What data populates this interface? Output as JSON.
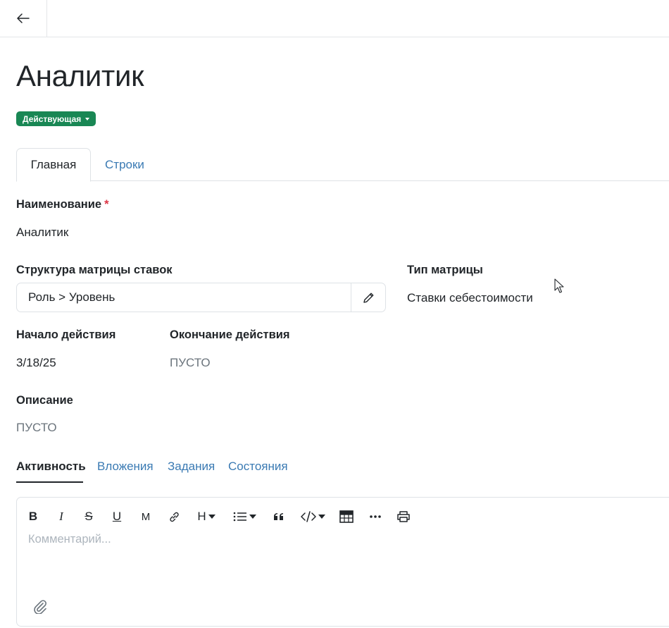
{
  "header": {
    "title": "Аналитик",
    "status": "Действующая"
  },
  "tabs": [
    {
      "label": "Главная",
      "active": true
    },
    {
      "label": "Строки",
      "active": false
    }
  ],
  "fields": {
    "name": {
      "label": "Наименование",
      "required_mark": "*",
      "value": "Аналитик"
    },
    "matrix_structure": {
      "label": "Структура матрицы ставок",
      "value": "Роль > Уровень"
    },
    "matrix_type": {
      "label": "Тип матрицы",
      "value": "Ставки себестоимости"
    },
    "start": {
      "label": "Начало действия",
      "value": "3/18/25"
    },
    "end": {
      "label": "Окончание действия",
      "value": "ПУСТО"
    },
    "description": {
      "label": "Описание",
      "value": "ПУСТО"
    }
  },
  "subtabs": [
    {
      "label": "Активность",
      "active": true
    },
    {
      "label": "Вложения",
      "active": false
    },
    {
      "label": "Задания",
      "active": false
    },
    {
      "label": "Состояния",
      "active": false
    }
  ],
  "editor": {
    "placeholder": "Комментарий...",
    "toolbar": {
      "bold": "B",
      "italic": "I",
      "strike": "S",
      "underline": "U",
      "mono": "M",
      "heading": "H"
    }
  },
  "colors": {
    "status_badge": "#198754",
    "link": "#3a7ab3",
    "required": "#dc3545"
  }
}
